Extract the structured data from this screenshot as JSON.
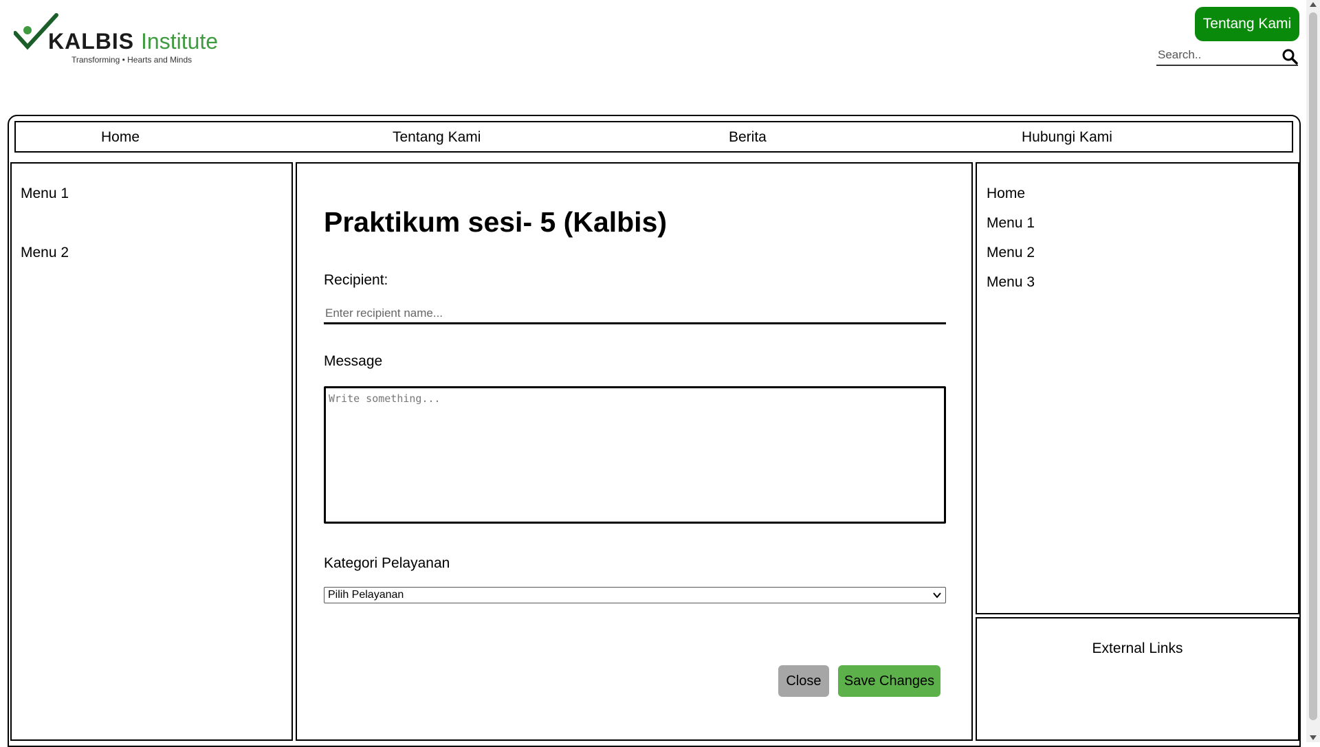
{
  "header": {
    "logo_brand": "KALBIS",
    "logo_suffix": "Institute",
    "logo_tagline": "Transforming • Hearts and Minds",
    "about_button": "Tentang Kami",
    "search_placeholder": "Search.."
  },
  "nav": {
    "items": [
      "Home",
      "Tentang Kami",
      "Berita",
      "Hubungi Kami"
    ]
  },
  "left_sidebar": {
    "items": [
      "Menu 1",
      "Menu 2"
    ]
  },
  "main": {
    "title": "Praktikum sesi- 5 (Kalbis)",
    "recipient_label": "Recipient:",
    "recipient_placeholder": "Enter recipient name...",
    "message_label": "Message",
    "message_placeholder": "Write something...",
    "category_label": "Kategori Pelayanan",
    "category_selected": "Pilih Pelayanan",
    "close_button": "Close",
    "save_button": "Save Changes"
  },
  "right_sidebar": {
    "items": [
      "Home",
      "Menu 1",
      "Menu 2",
      "Menu 3"
    ],
    "external_links_title": "External Links"
  },
  "colors": {
    "accent_green": "#0a8a0a",
    "save_green": "#5db14a",
    "close_gray": "#a6a6a6"
  },
  "icons": [
    "search-icon",
    "chevron-down-icon",
    "logo-check-icon"
  ]
}
